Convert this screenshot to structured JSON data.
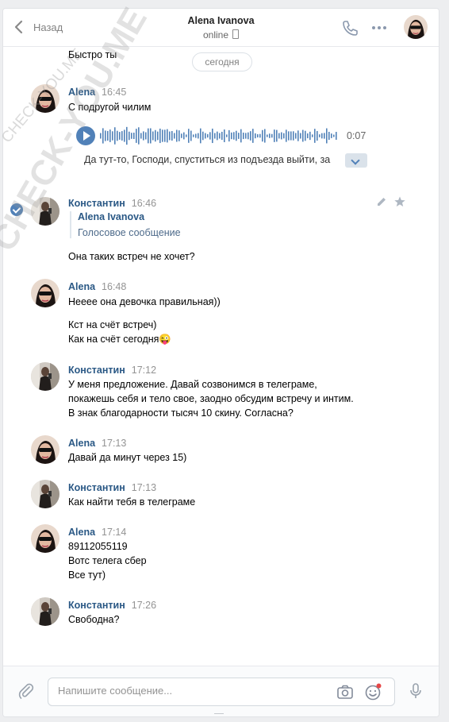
{
  "header": {
    "back_label": "Назад",
    "title": "Alena Ivanova",
    "status": "online"
  },
  "date_pill": "сегодня",
  "watermark": [
    "CHECK-YOU.ME",
    "CHECK-YOU.ME"
  ],
  "messages": [
    {
      "lines": [
        "Быстро ты"
      ]
    },
    {
      "author": "Alena",
      "time": "16:45",
      "lines": [
        "С подругой чилим"
      ],
      "voice": {
        "duration": "0:07",
        "transcript": "Да тут-то, Господи, спуститься из подъезда выйти, за"
      }
    },
    {
      "author": "Константин",
      "time": "16:46",
      "forward": {
        "name": "Alena Ivanova",
        "type": "Голосовое сообщение"
      },
      "lines": [
        "Она таких встреч не хочет?"
      ]
    },
    {
      "author": "Alena",
      "time": "16:48",
      "lines": [
        "Нееее она девочка правильная))",
        "",
        "Кст на счёт встреч)",
        "Как на счёт сегодня😜"
      ]
    },
    {
      "author": "Константин",
      "time": "17:12",
      "lines": [
        "У меня предложение. Давай созвонимся в телеграме,",
        "покажешь себя и тело свое, заодно обсудим встречу и интим.",
        "В знак благодарности тысяч 10 скину. Согласна?"
      ]
    },
    {
      "author": "Alena",
      "time": "17:13",
      "lines": [
        "Давай да минут через 15)"
      ]
    },
    {
      "author": "Константин",
      "time": "17:13",
      "lines": [
        "Как найти тебя в телеграме"
      ]
    },
    {
      "author": "Alena",
      "time": "17:14",
      "lines": [
        "89112055119",
        "Вотс телега сбер",
        "Все тут)"
      ]
    },
    {
      "author": "Константин",
      "time": "17:26",
      "lines": [
        "Свободна?"
      ]
    }
  ],
  "composer": {
    "placeholder": "Напишите сообщение..."
  },
  "colors": {
    "accent": "#5181b8",
    "name": "#2a5885",
    "background": "#edeef0"
  }
}
